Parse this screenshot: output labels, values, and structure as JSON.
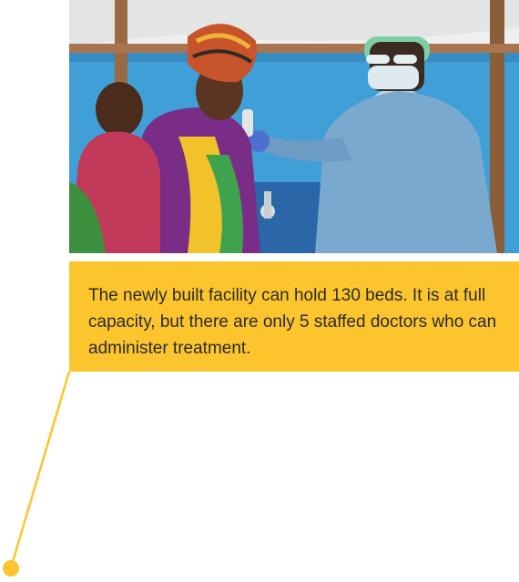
{
  "caption": {
    "text": "The newly built facility can hold 130 beds. It is at full capacity, but there are only 5 staffed doctors who can administer treatment."
  },
  "colors": {
    "accent": "#fcc52e",
    "caption_text": "#2b2b2b",
    "connector": "#fcc52e"
  },
  "icons": {
    "connector_endpoint": "dot-icon"
  }
}
